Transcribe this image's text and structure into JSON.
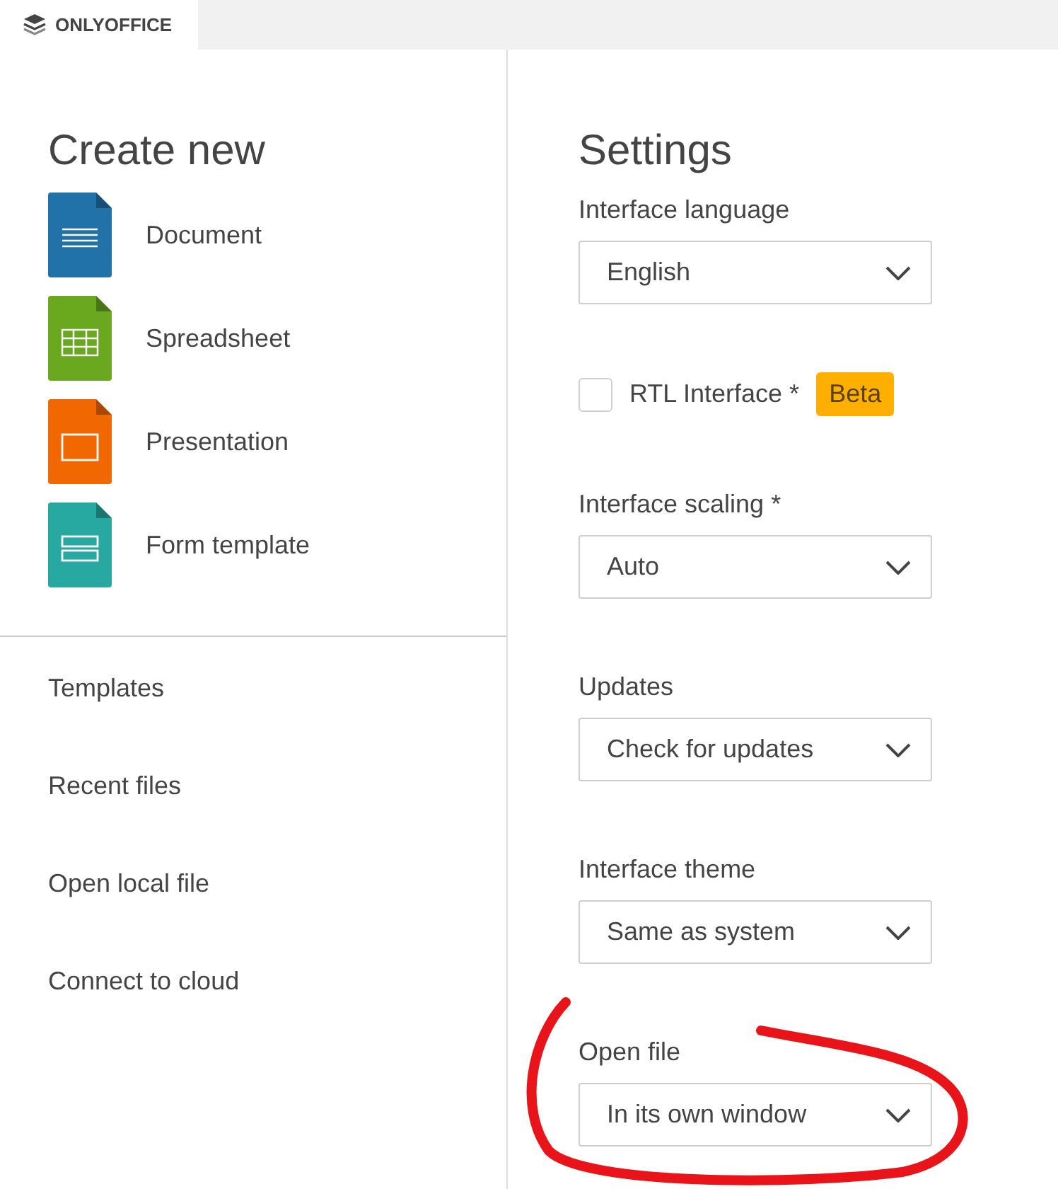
{
  "app": {
    "name": "ONLYOFFICE"
  },
  "create_new": {
    "title": "Create new",
    "items": [
      {
        "kind": "document",
        "label": "Document",
        "color": "#2172a9"
      },
      {
        "kind": "spreadsheet",
        "label": "Spreadsheet",
        "color": "#6aa820"
      },
      {
        "kind": "presentation",
        "label": "Presentation",
        "color": "#f26800"
      },
      {
        "kind": "form",
        "label": "Form template",
        "color": "#27a9a1"
      }
    ]
  },
  "nav": [
    "Templates",
    "Recent files",
    "Open local file",
    "Connect to cloud"
  ],
  "settings": {
    "title": "Settings",
    "items": [
      {
        "kind": "select",
        "label": "Interface language",
        "value": "English"
      },
      {
        "kind": "checkbox",
        "label": "RTL Interface *",
        "checked": false,
        "badge": "Beta"
      },
      {
        "kind": "select",
        "label": "Interface scaling *",
        "value": "Auto"
      },
      {
        "kind": "select",
        "label": "Updates",
        "value": "Check for updates"
      },
      {
        "kind": "select",
        "label": "Interface theme",
        "value": "Same as system"
      },
      {
        "kind": "select",
        "label": "Open file",
        "value": "In its own window"
      }
    ]
  }
}
